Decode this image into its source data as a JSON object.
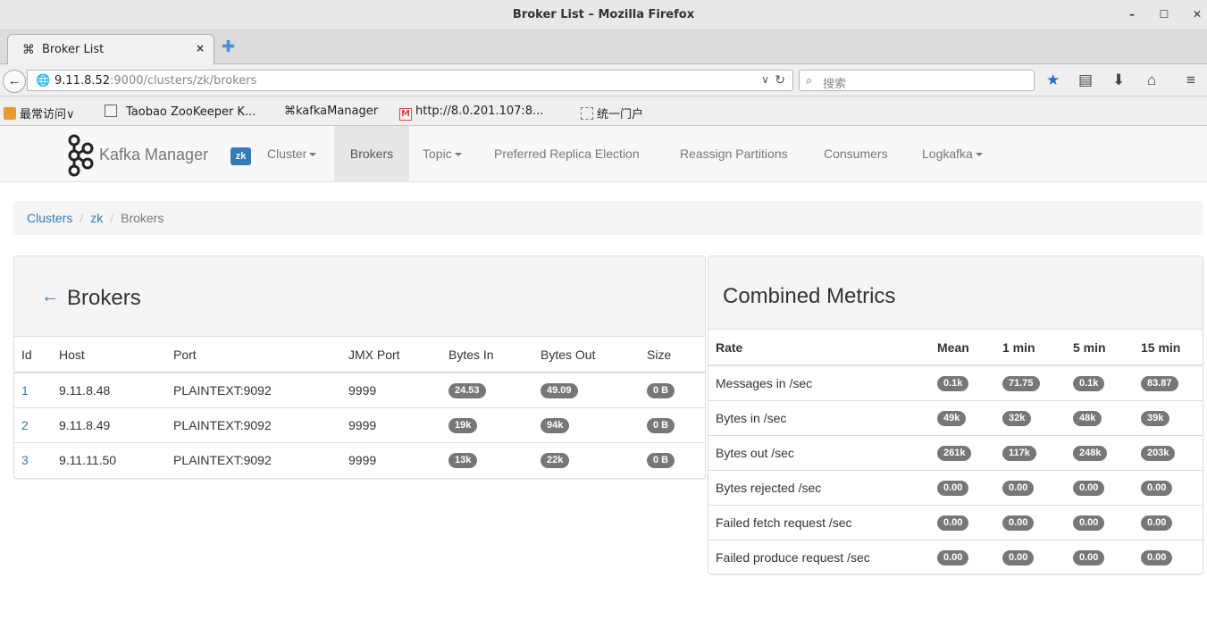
{
  "window": {
    "title": "Broker List – Mozilla Firefox",
    "controls": {
      "minimize": "–",
      "maximize": "☐",
      "close": "✕"
    }
  },
  "tab": {
    "label": "Broker List",
    "close": "×"
  },
  "address": {
    "host": "9.11.8.52",
    "path": ":9000/clusters/zk/brokers",
    "search_placeholder": "搜索"
  },
  "bookmarks": [
    {
      "label": "最常访问∨",
      "icon": "folder-icon"
    },
    {
      "label": "Taobao ZooKeeper K...",
      "icon": "image-icon"
    },
    {
      "label": "kafkaManager",
      "icon": "kafka-logo-icon"
    },
    {
      "label": "http://8.0.201.107:8...",
      "icon": "gmail-m-icon"
    },
    {
      "label": "统一门户",
      "icon": "page-icon"
    }
  ],
  "app": {
    "brand": "Kafka Manager",
    "cluster_badge": "zk",
    "nav": {
      "cluster": "Cluster",
      "brokers": "Brokers",
      "topic": "Topic",
      "preferred": "Preferred Replica Election",
      "reassign": "Reassign Partitions",
      "consumers": "Consumers",
      "logkafka": "Logkafka"
    }
  },
  "breadcrumb": {
    "clusters": "Clusters",
    "zk": "zk",
    "current": "Brokers",
    "sep": "/"
  },
  "brokers": {
    "title": "Brokers",
    "back_arrow": "←",
    "columns": {
      "id": "Id",
      "host": "Host",
      "port": "Port",
      "jmx": "JMX Port",
      "bytes_in": "Bytes In",
      "bytes_out": "Bytes Out",
      "size": "Size"
    },
    "rows": [
      {
        "id": "1",
        "host": "9.11.8.48",
        "port": "PLAINTEXT:9092",
        "jmx": "9999",
        "bytes_in": "24.53",
        "bytes_out": "49.09",
        "size": "0 B"
      },
      {
        "id": "2",
        "host": "9.11.8.49",
        "port": "PLAINTEXT:9092",
        "jmx": "9999",
        "bytes_in": "19k",
        "bytes_out": "94k",
        "size": "0 B"
      },
      {
        "id": "3",
        "host": "9.11.11.50",
        "port": "PLAINTEXT:9092",
        "jmx": "9999",
        "bytes_in": "13k",
        "bytes_out": "22k",
        "size": "0 B"
      }
    ]
  },
  "metrics": {
    "title": "Combined Metrics",
    "columns": {
      "rate": "Rate",
      "mean": "Mean",
      "m1": "1 min",
      "m5": "5 min",
      "m15": "15 min"
    },
    "rows": [
      {
        "rate": "Messages in /sec",
        "mean": "0.1k",
        "m1": "71.75",
        "m5": "0.1k",
        "m15": "83.87"
      },
      {
        "rate": "Bytes in /sec",
        "mean": "49k",
        "m1": "32k",
        "m5": "48k",
        "m15": "39k"
      },
      {
        "rate": "Bytes out /sec",
        "mean": "261k",
        "m1": "117k",
        "m5": "248k",
        "m15": "203k"
      },
      {
        "rate": "Bytes rejected /sec",
        "mean": "0.00",
        "m1": "0.00",
        "m5": "0.00",
        "m15": "0.00"
      },
      {
        "rate": "Failed fetch request /sec",
        "mean": "0.00",
        "m1": "0.00",
        "m5": "0.00",
        "m15": "0.00"
      },
      {
        "rate": "Failed produce request /sec",
        "mean": "0.00",
        "m1": "0.00",
        "m5": "0.00",
        "m15": "0.00"
      }
    ]
  }
}
